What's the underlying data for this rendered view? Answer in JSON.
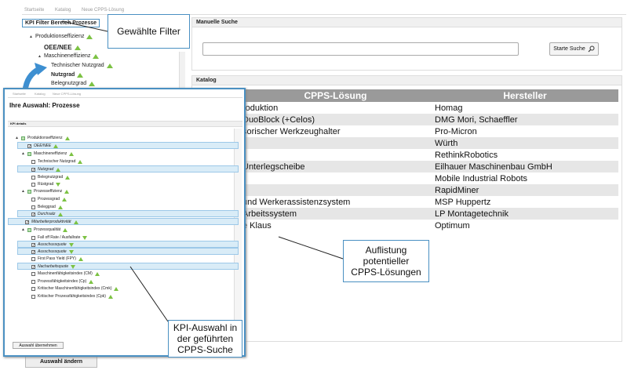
{
  "nav": [
    "Startseite",
    "Katalog",
    "Neue CPPS-Lösung"
  ],
  "filter_panel": {
    "title": "KPI Filter Bereich Prozesse",
    "items": [
      {
        "label": "Produktionseffizienz",
        "trend": "up"
      },
      {
        "label": "OEE/NEE",
        "trend": "up"
      },
      {
        "label": "Maschineneffizienz",
        "trend": "up"
      },
      {
        "label": "Technischer Nutzgrad",
        "trend": "up"
      },
      {
        "label": "Nutzgrad",
        "trend": "up"
      },
      {
        "label": "Belegnutzgrad",
        "trend": "up"
      }
    ],
    "change_button": "Auswahl ändern"
  },
  "search": {
    "title": "Manuelle Suche",
    "input_value": "",
    "button": "Starte Suche"
  },
  "catalog": {
    "title": "Katalog",
    "columns": [
      "CPPS-Lösung",
      "Hersteller"
    ],
    "rows": [
      [
        "roduktion",
        "Homag"
      ],
      [
        "DuoBlock (+Celos)",
        "DMG Mori, Schaeffler"
      ],
      [
        "sorischer Werkzeughalter",
        "Pro-Micron"
      ],
      [
        "",
        "Würth"
      ],
      [
        "",
        "RethinkRobotics"
      ],
      [
        "Unterlegscheibe",
        "Eilhauer Maschinenbau GmbH"
      ],
      [
        "",
        "Mobile Industrial Robots"
      ],
      [
        "",
        "RapidMiner"
      ],
      [
        "und Werkerassistenzsystem",
        "MSP Huppertz"
      ],
      [
        "Arbeitssystem",
        "LP Montagetechnik"
      ],
      [
        "e Klaus",
        "Optimum"
      ]
    ]
  },
  "popup": {
    "nav": [
      "Startseite",
      "Katalog",
      "Neue CPPS-Lösung"
    ],
    "title": "Ihre Auswahl: Prozesse",
    "section": "KPI details",
    "items": [
      {
        "label": "Produktionseffizienz",
        "trend": "up",
        "checked": false,
        "group": true
      },
      {
        "label": "OEE/NEE",
        "trend": "up",
        "checked": true,
        "group": false
      },
      {
        "label": "Maschineneffizienz",
        "trend": "up",
        "checked": false,
        "group": true
      },
      {
        "label": "Technischer Nutzgrad",
        "trend": "up",
        "checked": false,
        "group": false
      },
      {
        "label": "Nutzgrad",
        "trend": "up",
        "checked": true,
        "group": false
      },
      {
        "label": "Belegnutzgrad",
        "trend": "up",
        "checked": false,
        "group": false
      },
      {
        "label": "Rüstgrad",
        "trend": "down",
        "checked": false,
        "group": false
      },
      {
        "label": "Prozesseffizienz",
        "trend": "up",
        "checked": false,
        "group": true
      },
      {
        "label": "Prozessgrad",
        "trend": "up",
        "checked": false,
        "group": false
      },
      {
        "label": "Beleggrad",
        "trend": "up",
        "checked": false,
        "group": false
      },
      {
        "label": "Durchsatz",
        "trend": "up",
        "checked": true,
        "group": false
      },
      {
        "label": "Mitarbeiterproduktivität",
        "trend": "up",
        "checked": true,
        "group": false
      },
      {
        "label": "Prozessqualität",
        "trend": "up",
        "checked": false,
        "group": true
      },
      {
        "label": "Fall off Rate / Ausfallrate",
        "trend": "down",
        "checked": false,
        "group": false
      },
      {
        "label": "Ausschussquote",
        "trend": "down",
        "checked": true,
        "group": false
      },
      {
        "label": "Ausschussquote",
        "trend": "down",
        "checked": true,
        "group": false
      },
      {
        "label": "First Pass Yield (FPY)",
        "trend": "up",
        "checked": false,
        "group": false
      },
      {
        "label": "Nacharbeitsquote",
        "trend": "down",
        "checked": true,
        "group": false
      },
      {
        "label": "Maschinenfähigkeitsindex (CM)",
        "trend": "up",
        "checked": false,
        "group": false
      },
      {
        "label": "Prozessfähigkeitsindex (Cp)",
        "trend": "up",
        "checked": false,
        "group": false
      },
      {
        "label": "Kritischer Maschinenfähigkeitsindex (Cmk)",
        "trend": "up",
        "checked": false,
        "group": false
      },
      {
        "label": "Kritischer Prozessfähigkeitsindex (Cpk)",
        "trend": "up",
        "checked": false,
        "group": false
      }
    ],
    "apply_button": "Auswahl übernehmen"
  },
  "callouts": {
    "filter": "Gewählte Filter",
    "list": [
      "Auflistung",
      "potentieller",
      "CPPS-Lösungen"
    ],
    "kpi": [
      "KPI-Auswahl in",
      "der geführten",
      "CPPS-Suche"
    ]
  },
  "colors": {
    "accent": "#4a90c2",
    "trend": "#7cc243",
    "table_header": "#9a9a9a"
  }
}
